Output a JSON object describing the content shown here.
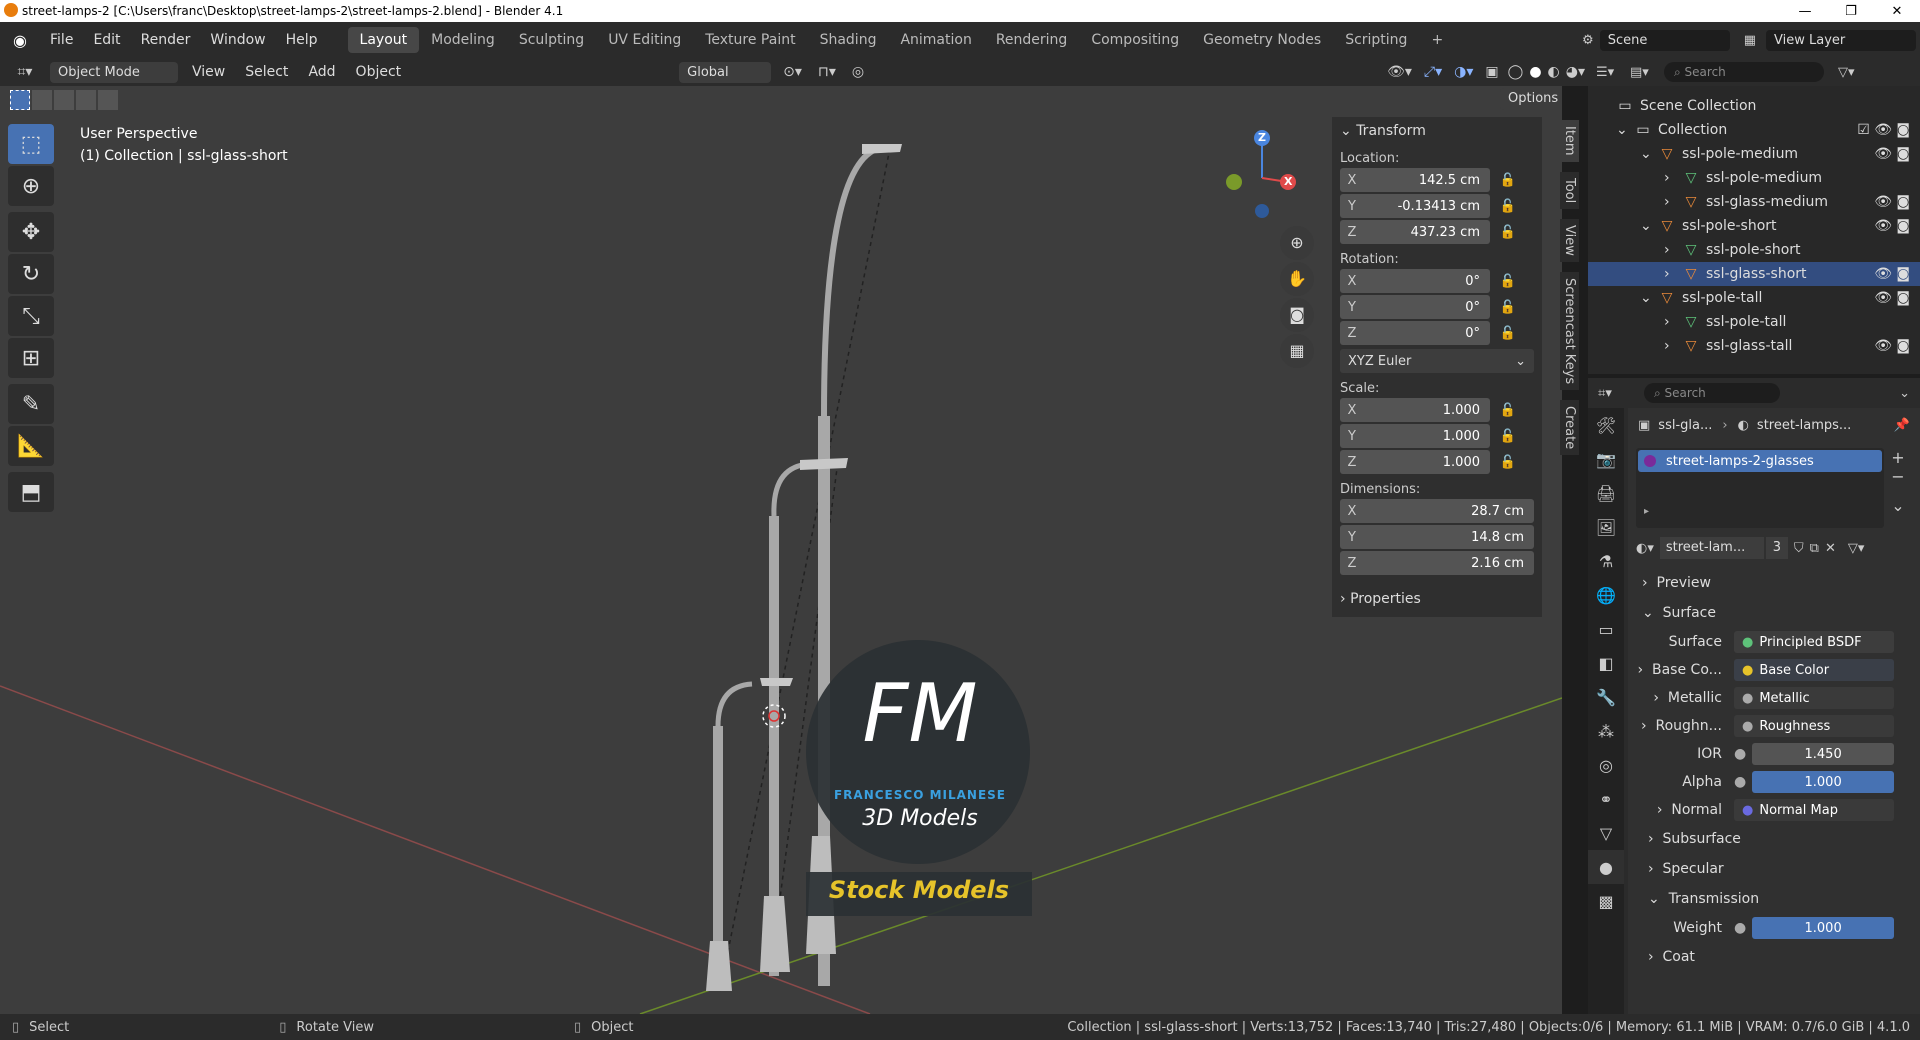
{
  "titlebar": {
    "title": "street-lamps-2 [C:\\Users\\franc\\Desktop\\street-lamps-2\\street-lamps-2.blend] - Blender 4.1",
    "min": "—",
    "max": "❐",
    "close": "✕"
  },
  "menus": [
    "File",
    "Edit",
    "Render",
    "Window",
    "Help"
  ],
  "workspaces": [
    "Layout",
    "Modeling",
    "Sculpting",
    "UV Editing",
    "Texture Paint",
    "Shading",
    "Animation",
    "Rendering",
    "Compositing",
    "Geometry Nodes",
    "Scripting"
  ],
  "scene": {
    "label": "Scene",
    "view_layer": "View Layer"
  },
  "header": {
    "mode": "Object Mode",
    "view": "View",
    "select": "Select",
    "add": "Add",
    "object": "Object",
    "transform": "Global",
    "options": "Options"
  },
  "viewport": {
    "perspective": "User Perspective",
    "collection": "(1) Collection | ssl-glass-short",
    "watermark_fm": "FM",
    "watermark_name": "FRANCESCO MILANESE",
    "watermark_3d": "3D Models",
    "watermark_stock": "Stock Models"
  },
  "gizmo": {
    "z": "Z",
    "x": "X"
  },
  "npanel": {
    "transform": "Transform",
    "location": "Location:",
    "rotation": "Rotation:",
    "scale": "Scale:",
    "dimensions": "Dimensions:",
    "properties": "Properties",
    "loc_x": "142.5 cm",
    "loc_y": "-0.13413 cm",
    "loc_z": "437.23 cm",
    "rot_x": "0°",
    "rot_y": "0°",
    "rot_z": "0°",
    "euler": "XYZ Euler",
    "scale_x": "1.000",
    "scale_y": "1.000",
    "scale_z": "1.000",
    "dim_x": "28.7 cm",
    "dim_y": "14.8 cm",
    "dim_z": "2.16 cm",
    "ax_x": "X",
    "ax_y": "Y",
    "ax_z": "Z"
  },
  "vtabs": [
    "Item",
    "Tool",
    "View",
    "Screencast Keys",
    "Create"
  ],
  "outliner": {
    "search": "Search",
    "items": [
      {
        "label": "Scene Collection",
        "indent": 0
      },
      {
        "label": "Collection",
        "indent": 1
      },
      {
        "label": "ssl-pole-medium",
        "indent": 2
      },
      {
        "label": "ssl-pole-medium",
        "indent": 3
      },
      {
        "label": "ssl-glass-medium",
        "indent": 3
      },
      {
        "label": "ssl-pole-short",
        "indent": 2
      },
      {
        "label": "ssl-pole-short",
        "indent": 3
      },
      {
        "label": "ssl-glass-short",
        "indent": 3
      },
      {
        "label": "ssl-pole-tall",
        "indent": 2
      },
      {
        "label": "ssl-pole-tall",
        "indent": 3
      },
      {
        "label": "ssl-glass-tall",
        "indent": 3
      }
    ]
  },
  "props": {
    "search": "Search",
    "breadcrumb_obj": "ssl-gla...",
    "breadcrumb_mat": "street-lamps...",
    "slot": "street-lamps-2-glasses",
    "material_name": "street-lam...",
    "users": "3",
    "preview": "Preview",
    "surface_sec": "Surface",
    "surface_lbl": "Surface",
    "surface_val": "Principled BSDF",
    "base_lbl": "Base Co...",
    "base_val": "Base Color",
    "metal_lbl": "Metallic",
    "metal_val": "Metallic",
    "rough_lbl": "Roughn...",
    "rough_val": "Roughness",
    "ior_lbl": "IOR",
    "ior_val": "1.450",
    "alpha_lbl": "Alpha",
    "alpha_val": "1.000",
    "normal_lbl": "Normal",
    "normal_val": "Normal Map",
    "subsurface": "Subsurface",
    "specular": "Specular",
    "transmission": "Transmission",
    "weight_lbl": "Weight",
    "weight_val": "1.000",
    "coat": "Coat"
  },
  "status": {
    "select": "Select",
    "rotate": "Rotate View",
    "object": "Object",
    "info": "Collection | ssl-glass-short | Verts:13,752 | Faces:13,740 | Tris:27,480 | Objects:0/6 | Memory: 61.1 MiB | VRAM: 0.7/6.0 GiB | 4.1.0"
  },
  "colors": {
    "accent": "#4772b3",
    "viewport": "#3d3d3d",
    "panel": "#2b2b2b"
  }
}
